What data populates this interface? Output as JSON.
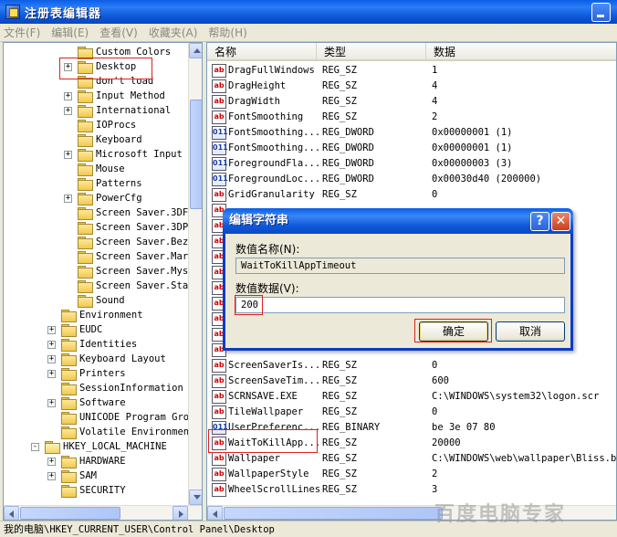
{
  "window": {
    "title": "注册表编辑器"
  },
  "menu": [
    "文件(F)",
    "编辑(E)",
    "查看(V)",
    "收藏夹(A)",
    "帮助(H)"
  ],
  "tree": [
    {
      "label": "Custom Colors",
      "indent": 4,
      "expander": "",
      "open": false
    },
    {
      "label": "Desktop",
      "indent": 4,
      "expander": "+",
      "open": false
    },
    {
      "label": "don't load",
      "indent": 4,
      "expander": "",
      "open": false
    },
    {
      "label": "Input Method",
      "indent": 4,
      "expander": "+",
      "open": false
    },
    {
      "label": "International",
      "indent": 4,
      "expander": "+",
      "open": false
    },
    {
      "label": "IOProcs",
      "indent": 4,
      "expander": "",
      "open": false
    },
    {
      "label": "Keyboard",
      "indent": 4,
      "expander": "",
      "open": false
    },
    {
      "label": "Microsoft Input",
      "indent": 4,
      "expander": "+",
      "open": false
    },
    {
      "label": "Mouse",
      "indent": 4,
      "expander": "",
      "open": false
    },
    {
      "label": "Patterns",
      "indent": 4,
      "expander": "",
      "open": false
    },
    {
      "label": "PowerCfg",
      "indent": 4,
      "expander": "+",
      "open": false
    },
    {
      "label": "Screen Saver.3DF",
      "indent": 4,
      "expander": "",
      "open": false
    },
    {
      "label": "Screen Saver.3DP",
      "indent": 4,
      "expander": "",
      "open": false
    },
    {
      "label": "Screen Saver.Bez",
      "indent": 4,
      "expander": "",
      "open": false
    },
    {
      "label": "Screen Saver.Mar",
      "indent": 4,
      "expander": "",
      "open": false
    },
    {
      "label": "Screen Saver.Mys",
      "indent": 4,
      "expander": "",
      "open": false
    },
    {
      "label": "Screen Saver.Sta",
      "indent": 4,
      "expander": "",
      "open": false
    },
    {
      "label": "Sound",
      "indent": 4,
      "expander": "",
      "open": false
    },
    {
      "label": "Environment",
      "indent": 3,
      "expander": "",
      "open": false
    },
    {
      "label": "EUDC",
      "indent": 3,
      "expander": "+",
      "open": false
    },
    {
      "label": "Identities",
      "indent": 3,
      "expander": "+",
      "open": false
    },
    {
      "label": "Keyboard Layout",
      "indent": 3,
      "expander": "+",
      "open": false
    },
    {
      "label": "Printers",
      "indent": 3,
      "expander": "+",
      "open": false
    },
    {
      "label": "SessionInformation",
      "indent": 3,
      "expander": "",
      "open": false
    },
    {
      "label": "Software",
      "indent": 3,
      "expander": "+",
      "open": false
    },
    {
      "label": "UNICODE Program Gro",
      "indent": 3,
      "expander": "",
      "open": false
    },
    {
      "label": "Volatile Environmen",
      "indent": 3,
      "expander": "",
      "open": false
    },
    {
      "label": "HKEY_LOCAL_MACHINE",
      "indent": 2,
      "expander": "-",
      "open": true
    },
    {
      "label": "HARDWARE",
      "indent": 3,
      "expander": "+",
      "open": false
    },
    {
      "label": "SAM",
      "indent": 3,
      "expander": "+",
      "open": false
    },
    {
      "label": "SECURITY",
      "indent": 3,
      "expander": "",
      "open": false
    }
  ],
  "list": {
    "headers": {
      "name": "名称",
      "type": "类型",
      "data": "数据"
    },
    "rows": [
      {
        "name": "DragFullWindows",
        "type": "REG_SZ",
        "data": "1",
        "icon": "ab"
      },
      {
        "name": "DragHeight",
        "type": "REG_SZ",
        "data": "4",
        "icon": "ab"
      },
      {
        "name": "DragWidth",
        "type": "REG_SZ",
        "data": "4",
        "icon": "ab"
      },
      {
        "name": "FontSmoothing",
        "type": "REG_SZ",
        "data": "2",
        "icon": "ab"
      },
      {
        "name": "FontSmoothing...",
        "type": "REG_DWORD",
        "data": "0x00000001 (1)",
        "icon": "bin"
      },
      {
        "name": "FontSmoothing...",
        "type": "REG_DWORD",
        "data": "0x00000001 (1)",
        "icon": "bin"
      },
      {
        "name": "ForegroundFla...",
        "type": "REG_DWORD",
        "data": "0x00000003 (3)",
        "icon": "bin"
      },
      {
        "name": "ForegroundLoc...",
        "type": "REG_DWORD",
        "data": "0x00030d40 (200000)",
        "icon": "bin"
      },
      {
        "name": "GridGranularity",
        "type": "REG_SZ",
        "data": "0",
        "icon": "ab"
      },
      {
        "name": "",
        "type": "",
        "data": "",
        "icon": "ab"
      },
      {
        "name": "",
        "type": "",
        "data": "",
        "icon": "ab"
      },
      {
        "name": "",
        "type": "",
        "data": "",
        "icon": "ab"
      },
      {
        "name": "",
        "type": "",
        "data": "",
        "icon": "ab"
      },
      {
        "name": "",
        "type": "",
        "data": "",
        "icon": "ab"
      },
      {
        "name": "",
        "type": "",
        "data": "",
        "icon": "ab"
      },
      {
        "name": "",
        "type": "",
        "data": "",
        "icon": "ab"
      },
      {
        "name": "",
        "type": "",
        "data": "",
        "icon": "ab"
      },
      {
        "name": "",
        "type": "",
        "data": "",
        "icon": "ab"
      },
      {
        "name": "",
        "type": "",
        "data": "",
        "icon": "ab"
      },
      {
        "name": "ScreenSaverIs...",
        "type": "REG_SZ",
        "data": "0",
        "icon": "ab"
      },
      {
        "name": "ScreenSaveTim...",
        "type": "REG_SZ",
        "data": "600",
        "icon": "ab"
      },
      {
        "name": "SCRNSAVE.EXE",
        "type": "REG_SZ",
        "data": "C:\\WINDOWS\\system32\\logon.scr",
        "icon": "ab"
      },
      {
        "name": "TileWallpaper",
        "type": "REG_SZ",
        "data": "0",
        "icon": "ab"
      },
      {
        "name": "UserPreferenc...",
        "type": "REG_BINARY",
        "data": "be 3e 07 80",
        "icon": "bin"
      },
      {
        "name": "WaitToKillApp...",
        "type": "REG_SZ",
        "data": "20000",
        "icon": "ab"
      },
      {
        "name": "Wallpaper",
        "type": "REG_SZ",
        "data": "C:\\WINDOWS\\web\\wallpaper\\Bliss.bmp",
        "icon": "ab"
      },
      {
        "name": "WallpaperStyle",
        "type": "REG_SZ",
        "data": "2",
        "icon": "ab"
      },
      {
        "name": "WheelScrollLines",
        "type": "REG_SZ",
        "data": "3",
        "icon": "ab"
      }
    ]
  },
  "dialog": {
    "title": "编辑字符串",
    "help_btn": "?",
    "close_btn": "✕",
    "name_label": "数值名称(N):",
    "name_value": "WaitToKillAppTimeout",
    "data_label": "数值数据(V):",
    "data_value": "200",
    "ok_label": "确定",
    "cancel_label": "取消"
  },
  "status": {
    "path": "我的电脑\\HKEY_CURRENT_USER\\Control Panel\\Desktop",
    "prefix": "我的电脑",
    "rest": "\\HKEY_CURRENT_USER\\Control Panel\\Desktop"
  },
  "watermark": "百度电脑专家",
  "colors": {
    "accent": "#0a5ee6",
    "highlight": "#e02020"
  }
}
